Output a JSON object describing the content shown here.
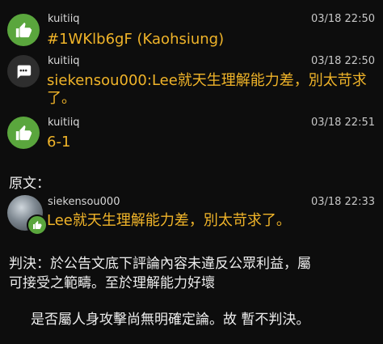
{
  "comments": [
    {
      "user": "kuitiiq",
      "time": "03/18 22:50",
      "text": "#1WKlb6gF (Kaohsiung)",
      "icon": "thumbs-up-icon"
    },
    {
      "user": "kuitiiq",
      "time": "03/18 22:50",
      "text": "siekensou000:Lee就天生理解能力差，別太苛求了。",
      "icon": "speech-bubble-icon"
    },
    {
      "user": "kuitiiq",
      "time": "03/18 22:51",
      "text": "6-1",
      "icon": "thumbs-up-icon"
    }
  ],
  "original_label": "原文：",
  "original": {
    "user": "siekensou000",
    "time": "03/18 22:33",
    "text": "Lee就天生理解能力差，別太苛求了。",
    "badge_icon": "thumbs-up-icon"
  },
  "verdict": {
    "line1": "判決：於公告文底下評論內容未違反公眾利益，屬",
    "line2": "可接受之範疇。至於理解能力好壞",
    "line3": "是否屬人身攻擊尚無明確定論。故 暫不判決。"
  },
  "colors": {
    "accent": "#f0b429",
    "green": "#5aa63d"
  }
}
